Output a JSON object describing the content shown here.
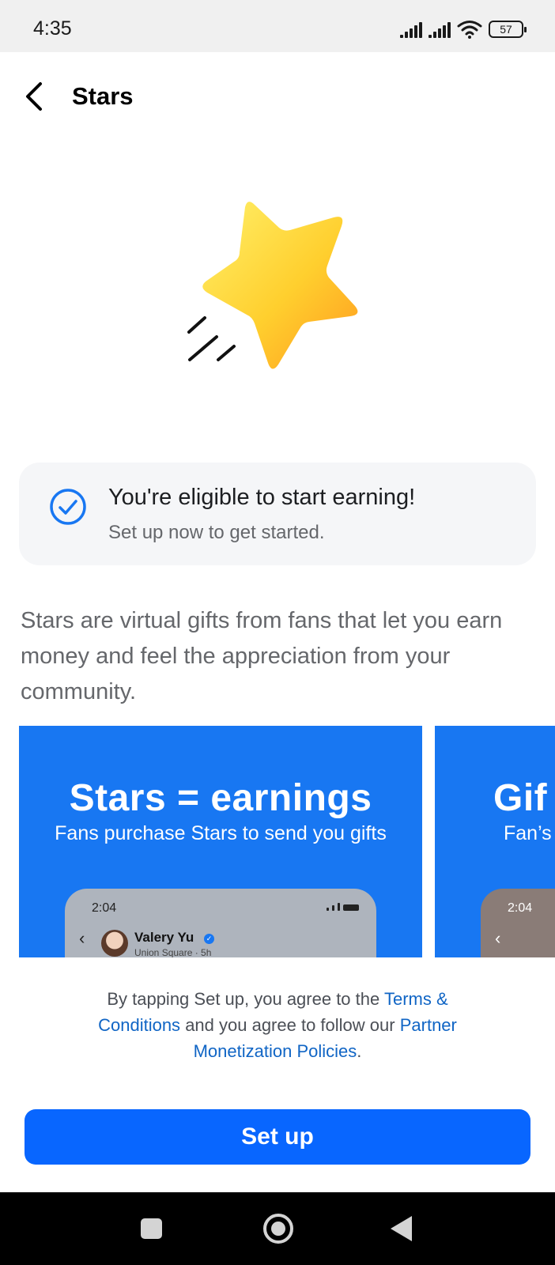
{
  "status_bar": {
    "time": "4:35",
    "battery": "57"
  },
  "header": {
    "title": "Stars"
  },
  "eligibility": {
    "title": "You're eligible to start earning!",
    "subtitle": "Set up now to get started."
  },
  "description": "Stars are virtual gifts from fans that let you earn money and feel the appreciation from your community.",
  "carousel": {
    "cards": [
      {
        "title": "Stars = earnings",
        "subtitle": "Fans purchase Stars to send you gifts",
        "phone_time": "2:04",
        "phone_name": "Valery Yu",
        "phone_location": "Union Square · 5h"
      },
      {
        "title": "Gif",
        "subtitle": "Fan’s",
        "phone_time": "2:04"
      }
    ]
  },
  "legal": {
    "part1": "By tapping Set up, you agree to the",
    "terms_link": "Terms & Conditions",
    "part2": "and you agree to follow our",
    "policies_link": "Partner Monetization Policies",
    "part3": "."
  },
  "setup_button": {
    "label": "Set up"
  },
  "colors": {
    "accent": "#0866ff",
    "card_blue": "#1877f2",
    "link": "#1065c5"
  }
}
